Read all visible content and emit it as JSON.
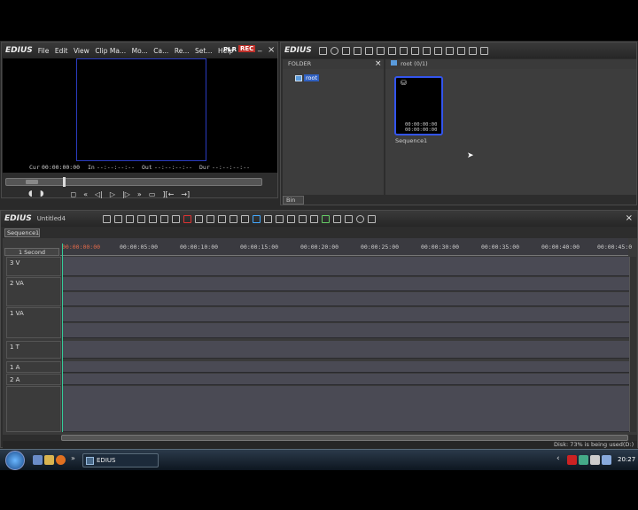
{
  "player": {
    "logo": "EDIUS",
    "menu": [
      "File",
      "Edit",
      "View",
      "Clip Ma...",
      "Mo...",
      "Ca...",
      "Re...",
      "Set...",
      "Help"
    ],
    "mode_plr": "PLR",
    "mode_rec": "REC",
    "close": "×",
    "minimize": "_",
    "timecodes": {
      "cur_label": "Cur",
      "cur": "00:00:00:00",
      "in_label": "In",
      "in": "--:--:--:--",
      "out_label": "Out",
      "out": "--:--:--:--",
      "dur_label": "Dur",
      "dur": "--:--:--:--"
    }
  },
  "bin": {
    "logo": "EDIUS",
    "folder_header": "FOLDER",
    "folder_close": "×",
    "root_label": "root",
    "content_header": "root (0/1)",
    "clip_label": "Sequence1",
    "clip_timecode_1": "00:00:00:00",
    "clip_timecode_2": "00:00:00:00",
    "tab": "Bin"
  },
  "timeline": {
    "logo": "EDIUS",
    "project": "Untitled4",
    "sequence_tab": "Sequence1",
    "scale": "1 Second",
    "close": "×",
    "tracks": [
      "3 V",
      "2 VA",
      "1 VA",
      "1 T",
      "1 A",
      "2 A"
    ],
    "ticks": [
      "00:00:00:00",
      "00:00:05:00",
      "00:00:10:00",
      "00:00:15:00",
      "00:00:20:00",
      "00:00:25:00",
      "00:00:30:00",
      "00:00:35:00",
      "00:00:40:00",
      "00:00:45:0"
    ],
    "status": "Disk: 73% is being used(D:)"
  },
  "taskbar": {
    "app_label": "EDIUS",
    "clock": "20:27"
  }
}
